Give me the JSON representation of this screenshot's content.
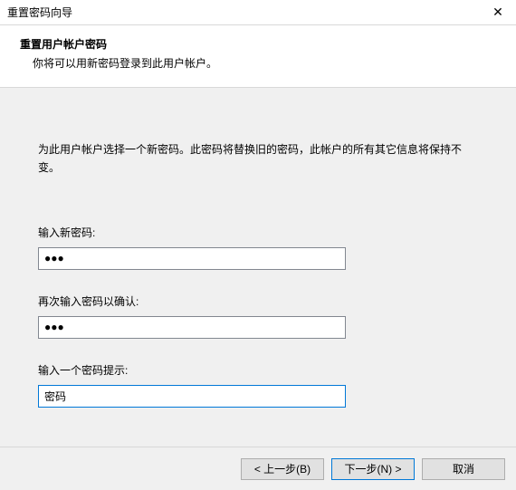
{
  "window": {
    "title": "重置密码向导",
    "close_glyph": "✕"
  },
  "header": {
    "main": "重置用户帐户密码",
    "sub": "你将可以用新密码登录到此用户帐户。"
  },
  "content": {
    "description": "为此用户帐户选择一个新密码。此密码将替换旧的密码，此帐户的所有其它信息将保持不变。",
    "fields": {
      "new_password": {
        "label": "输入新密码:",
        "value": "●●●"
      },
      "confirm_password": {
        "label": "再次输入密码以确认:",
        "value": "●●●"
      },
      "hint": {
        "label": "输入一个密码提示:",
        "value": "密码"
      }
    }
  },
  "footer": {
    "back": "< 上一步(B)",
    "next": "下一步(N) >",
    "cancel": "取消"
  }
}
